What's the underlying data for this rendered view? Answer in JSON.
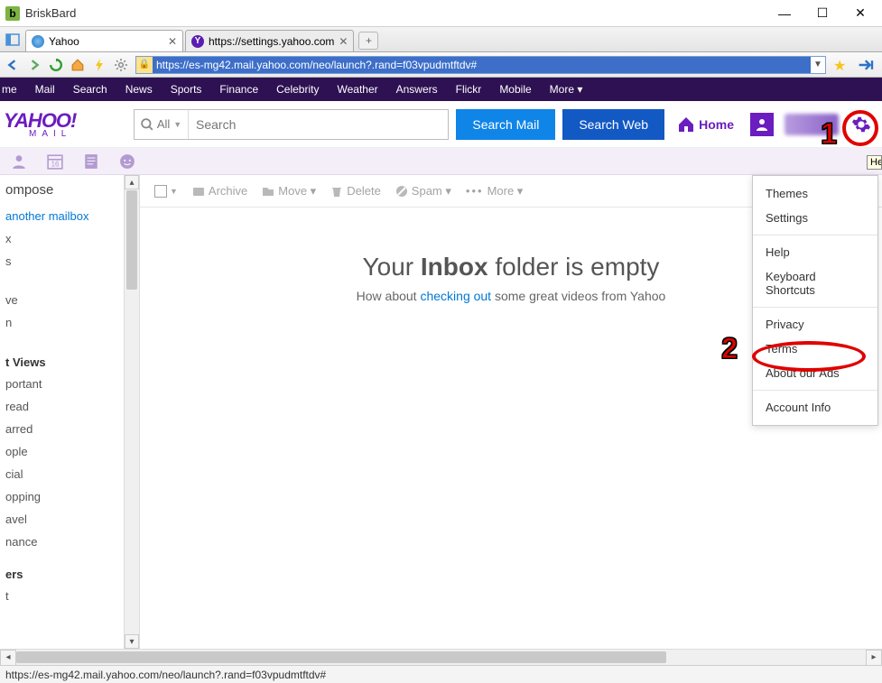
{
  "window": {
    "title": "BriskBard",
    "appBadge": "b"
  },
  "tabs": [
    {
      "title": "Yahoo",
      "favStyle": "globe"
    },
    {
      "title": "https://settings.yahoo.com",
      "favStyle": "y"
    }
  ],
  "addressBar": {
    "url": "https://es-mg42.mail.yahoo.com/neo/launch?.rand=f03vpudmtftdv#"
  },
  "yahooNav": {
    "items": [
      "me",
      "Mail",
      "Search",
      "News",
      "Sports",
      "Finance",
      "Celebrity",
      "Weather",
      "Answers",
      "Flickr",
      "Mobile",
      "More ▾"
    ]
  },
  "logo": {
    "line1": "YAHOO!",
    "line2": "MAIL"
  },
  "search": {
    "scope": "All",
    "placeholder": "Search",
    "mailBtn": "Search Mail",
    "webBtn": "Search Web"
  },
  "homeLabel": "Home",
  "mailToolbar": {
    "archive": "Archive",
    "move": "Move ▾",
    "delete": "Delete",
    "spam": "Spam ▾",
    "more": "More ▾"
  },
  "sidebar": {
    "compose": "ompose",
    "addMailbox": "another mailbox",
    "items1": [
      "x",
      "s",
      "",
      "ve",
      "n",
      "",
      "t Views"
    ],
    "smartItems": [
      "portant",
      "read",
      "arred",
      "ople",
      "cial",
      "opping",
      "avel",
      "nance"
    ],
    "foot": [
      "ers",
      "t"
    ]
  },
  "emptyInbox": {
    "prefix": "Your ",
    "bold": "Inbox",
    "suffix": " folder is empty",
    "sub1": "How about ",
    "link": "checking out",
    "sub2": " some great videos from Yahoo"
  },
  "settingsMenu": {
    "group1": [
      "Themes",
      "Settings"
    ],
    "group2": [
      "Help",
      "Keyboard Shortcuts"
    ],
    "group3": [
      "Privacy",
      "Terms",
      "About our Ads"
    ],
    "group4": [
      "Account Info"
    ]
  },
  "statusbar": "https://es-mg42.mail.yahoo.com/neo/launch?.rand=f03vpudmtftdv#",
  "tooltipFrag": "He",
  "annotations": {
    "one": "1",
    "two": "2"
  }
}
